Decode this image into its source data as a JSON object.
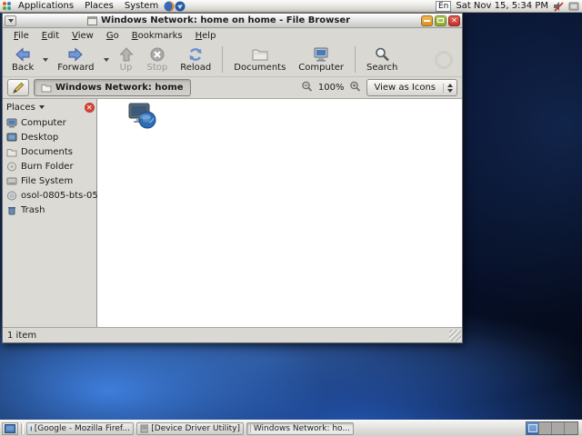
{
  "top_panel": {
    "menus": [
      {
        "label": "Applications"
      },
      {
        "label": "Places"
      },
      {
        "label": "System"
      }
    ],
    "keyboard_indicator": "En",
    "clock": "Sat Nov 15, 5:34 PM"
  },
  "window": {
    "title": "Windows Network: home on home - File Browser",
    "menubar": [
      {
        "label": "File"
      },
      {
        "label": "Edit"
      },
      {
        "label": "View"
      },
      {
        "label": "Go"
      },
      {
        "label": "Bookmarks"
      },
      {
        "label": "Help"
      }
    ],
    "toolbar": {
      "back": "Back",
      "forward": "Forward",
      "up": "Up",
      "stop": "Stop",
      "reload": "Reload",
      "documents": "Documents",
      "computer": "Computer",
      "search": "Search"
    },
    "location_bar": {
      "path_button": "Windows Network: home",
      "zoom_level": "100%",
      "view_mode": "View as Icons"
    },
    "sidebar": {
      "header": "Places",
      "items": [
        {
          "label": "Computer",
          "icon": "computer-icon"
        },
        {
          "label": "Desktop",
          "icon": "desktop-icon"
        },
        {
          "label": "Documents",
          "icon": "folder-icon"
        },
        {
          "label": "Burn Folder",
          "icon": "burn-disc-icon"
        },
        {
          "label": "File System",
          "icon": "drive-icon"
        },
        {
          "label": "osol-0805-bts-05",
          "icon": "optical-disc-icon"
        },
        {
          "label": "Trash",
          "icon": "trash-icon"
        }
      ]
    },
    "main_view": {
      "item_icon": "network-computer-icon"
    },
    "status_bar": "1 item"
  },
  "taskbar": {
    "buttons": [
      {
        "label": "[Google - Mozilla Firef...",
        "icon": "firefox-icon",
        "active": false
      },
      {
        "label": "[Device Driver Utility]",
        "icon": "application-icon",
        "active": false
      },
      {
        "label": "Windows Network: ho...",
        "icon": "window-icon",
        "active": true
      }
    ],
    "workspace_count": 4
  },
  "colors": {
    "close_button": "#c2342a",
    "maximize_button": "#8ca832",
    "minimize_button": "#d88f22",
    "wallpaper_bright_blue": "#4082e4",
    "wallpaper_dark_blue": "#07102a",
    "active_workspace": "#2e66b0"
  }
}
